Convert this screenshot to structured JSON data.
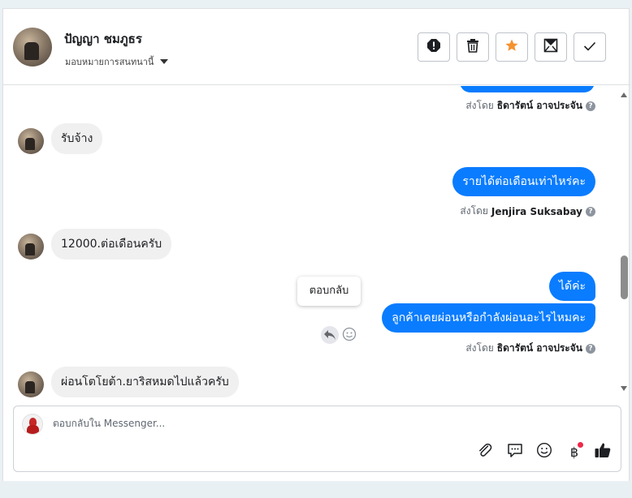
{
  "header": {
    "contact_name": "ปัญญา ชมภูธร",
    "assign_label": "มอบหมายการสนทนานี้",
    "actions": [
      "spam-icon",
      "trash-icon",
      "star-icon",
      "mark-unread-icon",
      "done-check-icon"
    ],
    "star_color": "#f5922f"
  },
  "conversation": {
    "m0": {
      "sent_by_prefix": "ส่งโดย",
      "sender": "ธิดารัตน์ อาจประจัน"
    },
    "m1": {
      "text": "รับจ้าง"
    },
    "m2": {
      "text": "รายได้ต่อเดือนเท่าไหร่คะ",
      "sent_by_prefix": "ส่งโดย",
      "sender": "Jenjira Suksabay"
    },
    "m3": {
      "text": "12000.ต่อเดือนครับ"
    },
    "m4": {
      "text": "ได้ค่ะ"
    },
    "m5": {
      "text": "ลูกค้าเคยผ่อนหรือกำลังผ่อนอะไรไหมคะ",
      "sent_by_prefix": "ส่งโดย",
      "sender": "ธิดารัตน์ อาจประจัน"
    },
    "m6": {
      "text": "ผ่อนโตโยต้า.ยาริสหมดไปแล้วครับ"
    },
    "tooltip": "ตอบกลับ",
    "help_glyph": "?"
  },
  "composer": {
    "placeholder": "ตอบกลับใน Messenger...",
    "tools": [
      "attach-icon",
      "saved-reply-icon",
      "emoji-icon",
      "payment-icon",
      "like-icon"
    ],
    "payment_glyph": "฿"
  },
  "colors": {
    "outgoing_bubble": "#0a7cff",
    "incoming_bubble": "#f0f0f0",
    "notification_dot": "#f02849"
  }
}
